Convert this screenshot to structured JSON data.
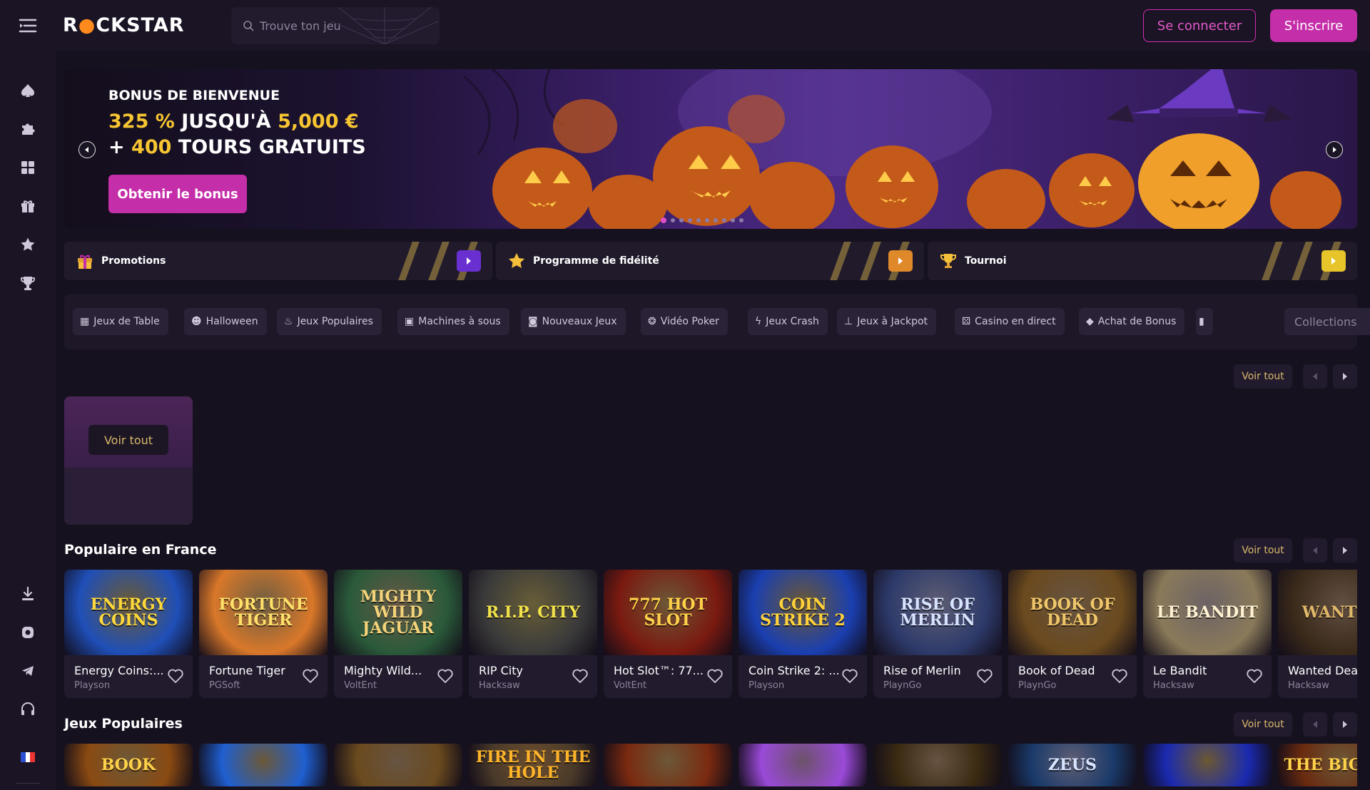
{
  "header": {
    "logo": "ROCKSTAR",
    "search_placeholder": "Trouve ton jeu",
    "login_label": "Se connecter",
    "signup_label": "S'inscrire"
  },
  "sidebar": {
    "icons": [
      "spade-icon",
      "puzzle-icon",
      "grid-icon",
      "gift-icon",
      "star-icon",
      "trophy-icon",
      "download-icon",
      "instagram-icon",
      "telegram-icon",
      "headset-icon",
      "france-flag-icon"
    ]
  },
  "hero": {
    "title": "BONUS DE BIENVENUE",
    "line1_a": "325 %",
    "line1_b": " JUSQU'À ",
    "line1_c": "5,000 €",
    "line2_a": "+ ",
    "line2_b": "400",
    "line2_c": " TOURS GRATUITS",
    "cta": "Obtenir le bonus",
    "slide_count": 10,
    "active_slide": 1
  },
  "promos": [
    {
      "label": "Promotions",
      "icon": "gift-icon",
      "accent": "#6a2fd0"
    },
    {
      "label": "Programme de fidélité",
      "icon": "star-icon",
      "accent": "#e0892a"
    },
    {
      "label": "Tournoi",
      "icon": "trophy-icon",
      "accent": "#e7c52a"
    }
  ],
  "categories": [
    {
      "label": "Jeux de Table",
      "icon": "cards-icon"
    },
    {
      "label": "Halloween",
      "icon": "ghost-icon"
    },
    {
      "label": "Jeux Populaires",
      "icon": "flame-icon"
    },
    {
      "label": "Machines à sous",
      "icon": "slot-icon"
    },
    {
      "label": "Nouveaux Jeux",
      "icon": "new-icon"
    },
    {
      "label": "Vidéo Poker",
      "icon": "chip-icon"
    },
    {
      "label": "Jeux Crash",
      "icon": "lightning-icon"
    },
    {
      "label": "Jeux à Jackpot",
      "icon": "joystick-icon"
    },
    {
      "label": "Casino en direct",
      "icon": "dice-icon"
    },
    {
      "label": "Achat de Bonus",
      "icon": "diamond-icon"
    }
  ],
  "collections_placeholder": "Collections",
  "voir_tout": "Voir tout",
  "sections": {
    "popular_france": {
      "title": "Populaire en France",
      "games": [
        {
          "name": "Energy Coins:...",
          "provider": "Playson",
          "thumb": "ENERGY COINS",
          "bg": "#1f4fb8",
          "fg": "#ffd93a"
        },
        {
          "name": "Fortune Tiger",
          "provider": "PGSoft",
          "thumb": "FORTUNE TIGER",
          "bg": "#d9782a",
          "fg": "#ffe16a"
        },
        {
          "name": "Mighty Wild...",
          "provider": "VoltEnt",
          "thumb": "MIGHTY WILD JAGUAR",
          "bg": "#2a5a3a",
          "fg": "#f4d37a"
        },
        {
          "name": "RIP City",
          "provider": "Hacksaw",
          "thumb": "R.I.P. CITY",
          "bg": "#3a3a3a",
          "fg": "#f2e24a"
        },
        {
          "name": "Hot Slot™: 77...",
          "provider": "VoltEnt",
          "thumb": "777 HOT SLOT",
          "bg": "#7a1a10",
          "fg": "#ffd24a"
        },
        {
          "name": "Coin Strike 2: ...",
          "provider": "Playson",
          "thumb": "COIN STRIKE 2",
          "bg": "#1a3fb0",
          "fg": "#ffd23a"
        },
        {
          "name": "Rise of Merlin",
          "provider": "PlaynGo",
          "thumb": "RISE OF MERLIN",
          "bg": "#2d3a6a",
          "fg": "#d8e4ff"
        },
        {
          "name": "Book of Dead",
          "provider": "PlaynGo",
          "thumb": "BOOK OF DEAD",
          "bg": "#6a4a1e",
          "fg": "#f0c66a"
        },
        {
          "name": "Le Bandit",
          "provider": "Hacksaw",
          "thumb": "LE BANDIT",
          "bg": "#8a7a5a",
          "fg": "#fff2d2"
        },
        {
          "name": "Wanted Dead",
          "provider": "Hacksaw",
          "thumb": "WANTED",
          "bg": "#3a2a1a",
          "fg": "#e0b86a"
        }
      ]
    },
    "popular_games": {
      "title": "Jeux Populaires",
      "games": [
        {
          "thumb": "BOOK",
          "bg": "#8a4a12",
          "fg": "#ffd24a"
        },
        {
          "thumb": "",
          "bg": "#1f5fd0",
          "fg": "#ffd24a"
        },
        {
          "thumb": "",
          "bg": "#6a4a1e",
          "fg": "#f0c66a"
        },
        {
          "thumb": "FIRE IN THE HOLE",
          "bg": "#4a3a2a",
          "fg": "#ffb42a"
        },
        {
          "thumb": "",
          "bg": "#7a2a10",
          "fg": "#ffd24a"
        },
        {
          "thumb": "",
          "bg": "#9a4ad8",
          "fg": "#ffc0e0"
        },
        {
          "thumb": "",
          "bg": "#3a2a12",
          "fg": "#f0c66a"
        },
        {
          "thumb": "ZEUS",
          "bg": "#1a3a6a",
          "fg": "#d8e4ff"
        },
        {
          "thumb": "",
          "bg": "#1a2ab0",
          "fg": "#ffd23a"
        },
        {
          "thumb": "THE BIGGER",
          "bg": "#6a2a10",
          "fg": "#ffd24a"
        }
      ]
    }
  }
}
